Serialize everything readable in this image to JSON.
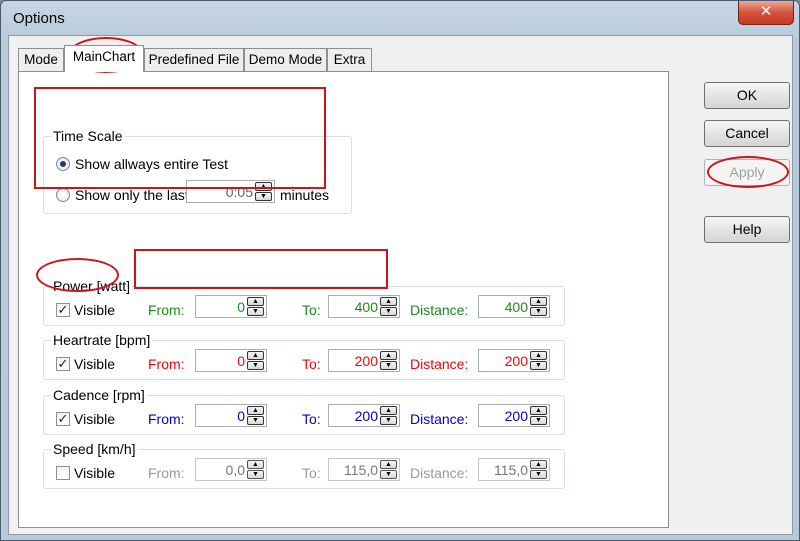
{
  "window": {
    "title": "Options",
    "close_glyph": "✕"
  },
  "tabs": [
    {
      "label": "Mode",
      "active": false
    },
    {
      "label": "MainChart",
      "active": true
    },
    {
      "label": "Predefined File",
      "active": false
    },
    {
      "label": "Demo Mode",
      "active": false
    },
    {
      "label": "Extra",
      "active": false
    }
  ],
  "buttons": {
    "ok": "OK",
    "cancel": "Cancel",
    "apply": "Apply",
    "help": "Help"
  },
  "time_scale": {
    "title": "Time Scale",
    "option_entire": "Show allways entire Test",
    "option_last": "Show only the last",
    "selected": "entire",
    "last_value": "0:05",
    "unit": "minutes"
  },
  "ranges": [
    {
      "title": "Power [watt]",
      "visible": true,
      "visible_label": "Visible",
      "from_label": "From:",
      "from": "0",
      "to_label": "To:",
      "to": "400",
      "distance_label": "Distance:",
      "distance": "400",
      "color": "#1a8a1a"
    },
    {
      "title": "Heartrate [bpm]",
      "visible": true,
      "visible_label": "Visible",
      "from_label": "From:",
      "from": "0",
      "to_label": "To:",
      "to": "200",
      "distance_label": "Distance:",
      "distance": "200",
      "color": "#ff0000"
    },
    {
      "title": "Cadence [rpm]",
      "visible": true,
      "visible_label": "Visible",
      "from_label": "From:",
      "from": "0",
      "to_label": "To:",
      "to": "200",
      "distance_label": "Distance:",
      "distance": "200",
      "color": "#0000d0"
    },
    {
      "title": "Speed [km/h]",
      "visible": false,
      "visible_label": "Visible",
      "from_label": "From:",
      "from": "0,0",
      "to_label": "To:",
      "to": "115,0",
      "distance_label": "Distance:",
      "distance": "115,0",
      "color": "#9a9a9a"
    }
  ],
  "icons": {
    "check": "✓",
    "spin_up": "▲",
    "spin_down": "▼"
  },
  "colors": {
    "annotation": "#d0131a"
  }
}
